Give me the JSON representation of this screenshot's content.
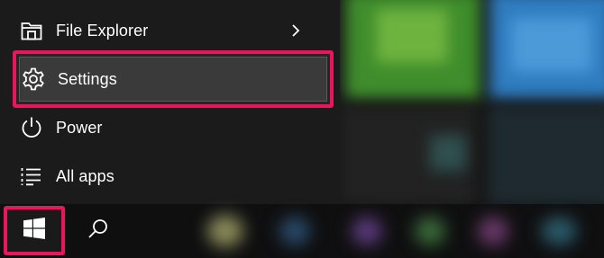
{
  "start_menu": {
    "items": [
      {
        "label": "File Explorer",
        "icon": "folder-icon",
        "has_submenu": true
      },
      {
        "label": "Settings",
        "icon": "gear-icon",
        "highlighted": true
      },
      {
        "label": "Power",
        "icon": "power-icon"
      },
      {
        "label": "All apps",
        "icon": "list-icon"
      }
    ]
  },
  "taskbar": {
    "start_icon": "windows-logo-icon",
    "search_icon": "search-icon"
  },
  "colors": {
    "highlight_border": "#e8175d",
    "menu_background": "#1b1b1b",
    "selected_item_background": "#3a3a3a",
    "text": "#ffffff",
    "tile_green": "#3a8a2a",
    "tile_blue": "#2a6fa8"
  }
}
